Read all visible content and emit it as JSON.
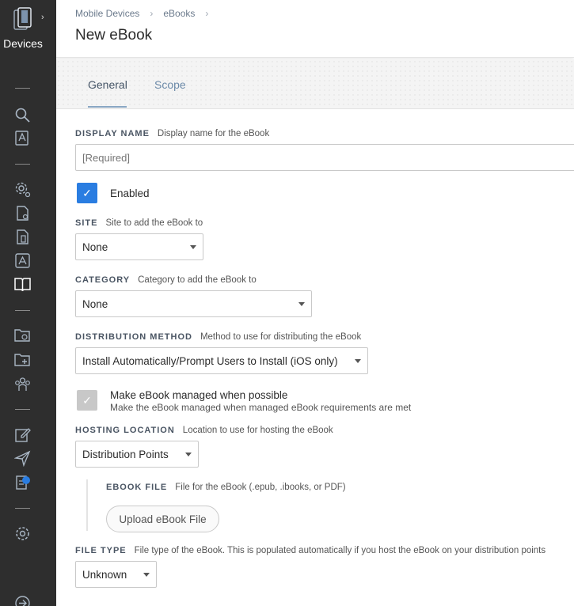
{
  "sidebar": {
    "title": "Devices",
    "icons": [
      "devices-icon",
      "search-icon",
      "mobile-search-icon",
      "settings-gear-icon",
      "document-gear-icon",
      "document-mobile-icon",
      "app-store-icon",
      "ebook-icon",
      "folder-sync-icon",
      "folder-add-icon",
      "groups-icon",
      "edit-icon",
      "send-icon",
      "notifications-icon",
      "gear-icon",
      "arrow-right-circle-icon"
    ]
  },
  "header": {
    "breadcrumb": [
      "Mobile Devices",
      "eBooks"
    ],
    "title": "New eBook"
  },
  "tabs": [
    {
      "label": "General"
    },
    {
      "label": "Scope"
    }
  ],
  "form": {
    "display_name": {
      "label": "DISPLAY NAME",
      "hint": "Display name for the eBook",
      "placeholder": "[Required]",
      "value": ""
    },
    "enabled": {
      "label": "Enabled",
      "checked": true
    },
    "site": {
      "label": "SITE",
      "hint": "Site to add the eBook to",
      "value": "None"
    },
    "category": {
      "label": "CATEGORY",
      "hint": "Category to add the eBook to",
      "value": "None"
    },
    "distribution": {
      "label": "DISTRIBUTION METHOD",
      "hint": "Method to use for distributing the eBook",
      "value": "Install Automatically/Prompt Users to Install (iOS only)"
    },
    "managed": {
      "label": "Make eBook managed when possible",
      "sub": "Make the eBook managed when managed eBook requirements are met",
      "checked": true
    },
    "hosting": {
      "label": "HOSTING LOCATION",
      "hint": "Location to use for hosting the eBook",
      "value": "Distribution Points"
    },
    "ebook_file": {
      "label": "EBOOK FILE",
      "hint": "File for the eBook (.epub, .ibooks, or PDF)",
      "button": "Upload eBook File"
    },
    "file_type": {
      "label": "FILE TYPE",
      "hint": "File type of the eBook. This is populated automatically if you host the eBook on your distribution points",
      "value": "Unknown"
    }
  },
  "colors": {
    "sidebar": "#2e2e2e",
    "accent": "#2a7de1"
  }
}
